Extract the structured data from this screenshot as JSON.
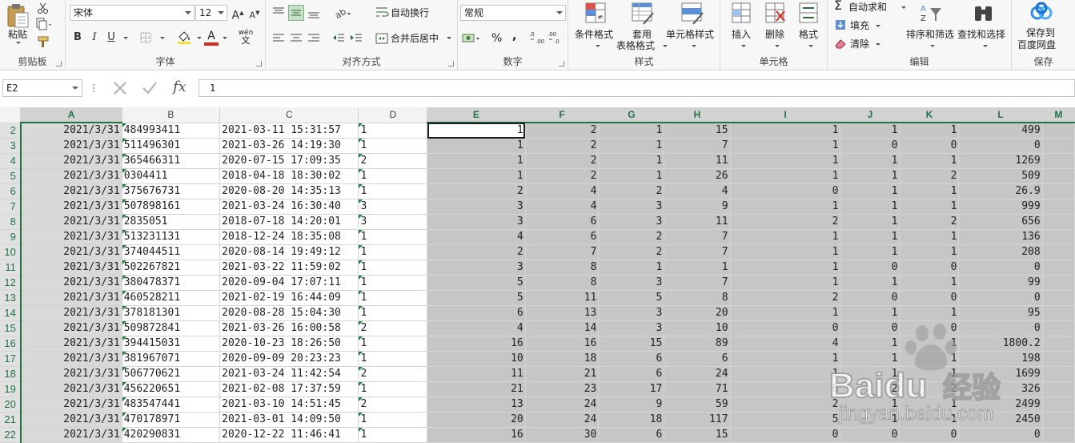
{
  "ribbon": {
    "clipboard": {
      "label": "剪贴板",
      "paste": "粘贴"
    },
    "font": {
      "label": "字体",
      "name": "宋体",
      "size": "12",
      "bold": "B",
      "italic": "I",
      "underline": "U",
      "grow": "A",
      "shrink": "A",
      "font_color_letter": "A",
      "phonetic": "wén",
      "colors": {
        "highlight": "#f7e03c",
        "font": "#d7281e"
      }
    },
    "alignment": {
      "label": "对齐方式",
      "wrap": "自动换行",
      "merge": "合并后居中"
    },
    "number": {
      "label": "数字",
      "format": "常规",
      "percent": "%",
      "comma": ","
    },
    "styles": {
      "label": "样式",
      "conditional": "条件格式",
      "table_line1": "套用",
      "table_line2": "表格格式",
      "cell_styles": "单元格样式"
    },
    "cells": {
      "label": "单元格",
      "insert": "插入",
      "delete": "删除",
      "format": "格式"
    },
    "editing": {
      "label": "编辑",
      "autosum": "自动求和",
      "fill": "填充",
      "clear": "清除",
      "sort_filter": "排序和筛选",
      "find_select": "查找和选择"
    },
    "save": {
      "label": "保存",
      "line1": "保存到",
      "line2": "百度网盘"
    }
  },
  "formula_bar": {
    "name_box": "E2",
    "fx": "fx",
    "value": "1"
  },
  "grid": {
    "columns": [
      "A",
      "B",
      "C",
      "D",
      "E",
      "F",
      "G",
      "H",
      "I",
      "J",
      "K",
      "L",
      "M"
    ],
    "rows": [
      {
        "n": "2",
        "a": "2021/3/31",
        "b": "484993411",
        "c": "2021-03-11  15:31:57",
        "d": "1",
        "e": "1",
        "f": "2",
        "g": "1",
        "h": "15",
        "i": "1",
        "j": "1",
        "k": "1",
        "l": "499"
      },
      {
        "n": "3",
        "a": "2021/3/31",
        "b": "511496301",
        "c": "2021-03-26  14:19:30",
        "d": "1",
        "e": "1",
        "f": "2",
        "g": "1",
        "h": "7",
        "i": "1",
        "j": "0",
        "k": "0",
        "l": "0"
      },
      {
        "n": "4",
        "a": "2021/3/31",
        "b": "365466311",
        "c": "2020-07-15  17:09:35",
        "d": "2",
        "e": "1",
        "f": "2",
        "g": "1",
        "h": "11",
        "i": "1",
        "j": "1",
        "k": "1",
        "l": "1269"
      },
      {
        "n": "5",
        "a": "2021/3/31",
        "b": "0304411",
        "c": "2018-04-18  18:30:02",
        "d": "1",
        "e": "1",
        "f": "2",
        "g": "1",
        "h": "26",
        "i": "1",
        "j": "1",
        "k": "2",
        "l": "509"
      },
      {
        "n": "6",
        "a": "2021/3/31",
        "b": "375676731",
        "c": "2020-08-20  14:35:13",
        "d": "1",
        "e": "2",
        "f": "4",
        "g": "2",
        "h": "4",
        "i": "0",
        "j": "1",
        "k": "1",
        "l": "26.9"
      },
      {
        "n": "7",
        "a": "2021/3/31",
        "b": "507898161",
        "c": "2021-03-24  16:30:40",
        "d": "3",
        "e": "3",
        "f": "4",
        "g": "3",
        "h": "9",
        "i": "1",
        "j": "1",
        "k": "1",
        "l": "999"
      },
      {
        "n": "8",
        "a": "2021/3/31",
        "b": "2835051",
        "c": "2018-07-18  14:20:01",
        "d": "3",
        "e": "3",
        "f": "6",
        "g": "3",
        "h": "11",
        "i": "2",
        "j": "1",
        "k": "2",
        "l": "656"
      },
      {
        "n": "9",
        "a": "2021/3/31",
        "b": "513231131",
        "c": "2018-12-24  18:35:08",
        "d": "1",
        "e": "4",
        "f": "6",
        "g": "2",
        "h": "7",
        "i": "1",
        "j": "1",
        "k": "1",
        "l": "136"
      },
      {
        "n": "10",
        "a": "2021/3/31",
        "b": "374044511",
        "c": "2020-08-14  19:49:12",
        "d": "1",
        "e": "2",
        "f": "7",
        "g": "2",
        "h": "7",
        "i": "1",
        "j": "1",
        "k": "1",
        "l": "208"
      },
      {
        "n": "11",
        "a": "2021/3/31",
        "b": "502267821",
        "c": "2021-03-22  11:59:02",
        "d": "1",
        "e": "3",
        "f": "8",
        "g": "1",
        "h": "1",
        "i": "1",
        "j": "0",
        "k": "0",
        "l": "0"
      },
      {
        "n": "12",
        "a": "2021/3/31",
        "b": "380478371",
        "c": "2020-09-04  17:07:11",
        "d": "1",
        "e": "5",
        "f": "8",
        "g": "3",
        "h": "7",
        "i": "1",
        "j": "1",
        "k": "1",
        "l": "99"
      },
      {
        "n": "13",
        "a": "2021/3/31",
        "b": "460528211",
        "c": "2021-02-19  16:44:09",
        "d": "1",
        "e": "5",
        "f": "11",
        "g": "5",
        "h": "8",
        "i": "2",
        "j": "0",
        "k": "0",
        "l": "0"
      },
      {
        "n": "14",
        "a": "2021/3/31",
        "b": "378181301",
        "c": "2020-08-28  15:04:30",
        "d": "1",
        "e": "6",
        "f": "13",
        "g": "3",
        "h": "20",
        "i": "1",
        "j": "1",
        "k": "1",
        "l": "95"
      },
      {
        "n": "15",
        "a": "2021/3/31",
        "b": "509872841",
        "c": "2021-03-26  16:00:58",
        "d": "2",
        "e": "4",
        "f": "14",
        "g": "3",
        "h": "10",
        "i": "0",
        "j": "0",
        "k": "0",
        "l": "0"
      },
      {
        "n": "16",
        "a": "2021/3/31",
        "b": "394415031",
        "c": "2020-10-23  18:26:50",
        "d": "1",
        "e": "16",
        "f": "16",
        "g": "15",
        "h": "89",
        "i": "4",
        "j": "1",
        "k": "1",
        "l": "1800.2"
      },
      {
        "n": "17",
        "a": "2021/3/31",
        "b": "381967071",
        "c": "2020-09-09  20:23:23",
        "d": "1",
        "e": "10",
        "f": "18",
        "g": "6",
        "h": "6",
        "i": "1",
        "j": "1",
        "k": "1",
        "l": "198"
      },
      {
        "n": "18",
        "a": "2021/3/31",
        "b": "506770621",
        "c": "2021-03-24  11:42:54",
        "d": "2",
        "e": "11",
        "f": "21",
        "g": "6",
        "h": "24",
        "i": "1",
        "j": "1",
        "k": "1",
        "l": "1699"
      },
      {
        "n": "19",
        "a": "2021/3/31",
        "b": "456220651",
        "c": "2021-02-08  17:37:59",
        "d": "1",
        "e": "21",
        "f": "23",
        "g": "17",
        "h": "71",
        "i": "6",
        "j": "2",
        "k": "2",
        "l": "326"
      },
      {
        "n": "20",
        "a": "2021/3/31",
        "b": "483547441",
        "c": "2021-03-10  14:51:45",
        "d": "2",
        "e": "13",
        "f": "24",
        "g": "9",
        "h": "59",
        "i": "2",
        "j": "1",
        "k": "1",
        "l": "2499"
      },
      {
        "n": "21",
        "a": "2021/3/31",
        "b": "470178971",
        "c": "2021-03-01  14:09:50",
        "d": "1",
        "e": "20",
        "f": "24",
        "g": "18",
        "h": "117",
        "i": "5",
        "j": "1",
        "k": "1",
        "l": "2450"
      },
      {
        "n": "22",
        "a": "2021/3/31",
        "b": "420290831",
        "c": "2020-12-22  11:46:41",
        "d": "1",
        "e": "16",
        "f": "30",
        "g": "6",
        "h": "15",
        "i": "0",
        "j": "0",
        "k": "0",
        "l": "0"
      }
    ]
  },
  "watermark": {
    "brand": "Baidu",
    "brand_suffix": "经验",
    "url": "jingyan.baidu.com"
  }
}
